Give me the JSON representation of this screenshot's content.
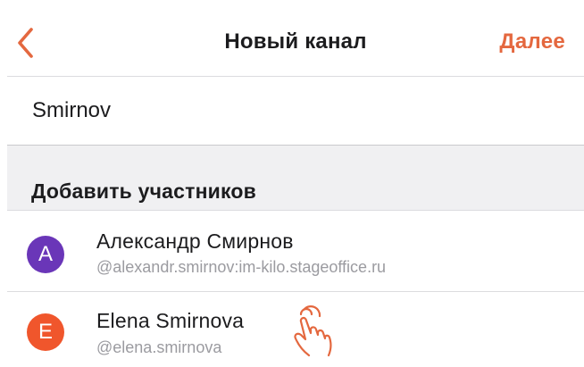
{
  "navbar": {
    "title": "Новый канал",
    "next_label": "Далее",
    "back_icon": "chevron-left-icon"
  },
  "search": {
    "value": "Smirnov"
  },
  "section": {
    "title": "Добавить участников"
  },
  "contacts": [
    {
      "initial": "A",
      "name": "Александр Смирнов",
      "id": "@alexandr.smirnov:im-kilo.stageoffice.ru",
      "avatar_color": "#6a36b8"
    },
    {
      "initial": "E",
      "name": "Elena Smirnova",
      "id": "@elena.smirnova",
      "avatar_color": "#f0562c"
    }
  ],
  "overlay": {
    "pointer_icon": "hand-tap-icon"
  },
  "colors": {
    "accent": "#e4683f",
    "section_background": "#f0f0f2",
    "secondary_text": "#9b9ba0"
  }
}
